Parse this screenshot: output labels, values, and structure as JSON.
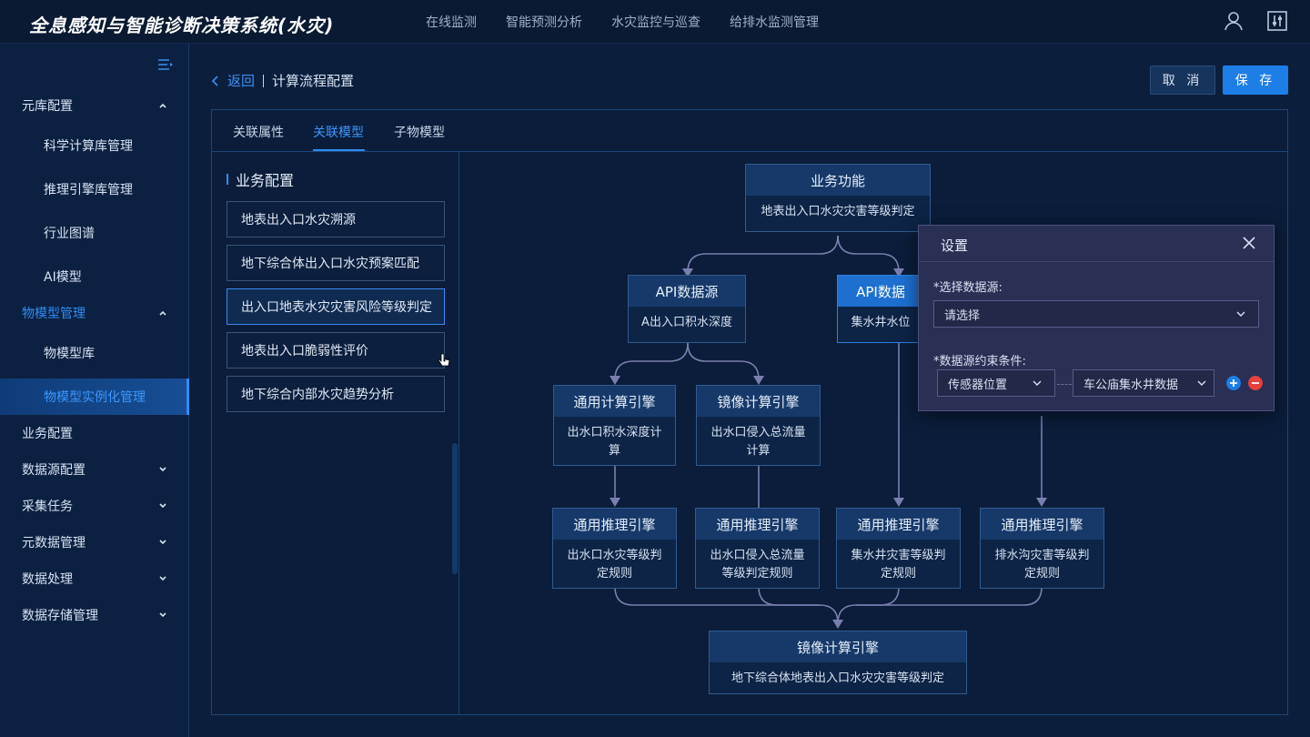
{
  "header": {
    "app_title": "全息感知与智能诊断决策系统(水灾)",
    "nav": [
      "在线监测",
      "智能预测分析",
      "水灾监控与巡查",
      "给排水监测管理"
    ],
    "user_icon": "user-icon",
    "settings_icon": "sliders-icon"
  },
  "sidebar": {
    "items": [
      {
        "label": "元库配置",
        "level": 1,
        "state": "expanded"
      },
      {
        "label": "科学计算库管理",
        "level": 2
      },
      {
        "label": "推理引擎库管理",
        "level": 2
      },
      {
        "label": "行业图谱",
        "level": 2
      },
      {
        "label": "AI模型",
        "level": 2
      },
      {
        "label": "物模型管理",
        "level": 1,
        "state": "expanded"
      },
      {
        "label": "物模型库",
        "level": 2
      },
      {
        "label": "物模型实例化管理",
        "level": 2,
        "state": "active"
      },
      {
        "label": "业务配置",
        "level": 1
      },
      {
        "label": "数据源配置",
        "level": 1,
        "state": "collapsed"
      },
      {
        "label": "采集任务",
        "level": 1,
        "state": "collapsed"
      },
      {
        "label": "元数据管理",
        "level": 1,
        "state": "collapsed"
      },
      {
        "label": "数据处理",
        "level": 1,
        "state": "collapsed"
      },
      {
        "label": "数据存储管理",
        "level": 1,
        "state": "collapsed"
      }
    ]
  },
  "breadcrumb": {
    "back": "返回",
    "title": "计算流程配置"
  },
  "actions": {
    "cancel": "取 消",
    "save": "保 存"
  },
  "tabs": [
    {
      "label": "关联属性"
    },
    {
      "label": "关联模型",
      "active": true
    },
    {
      "label": "子物模型"
    }
  ],
  "business": {
    "title": "业务配置",
    "items": [
      "地表出入口水灾溯源",
      "地下综合体出入口水灾预案匹配",
      "出入口地表水灾灾害风险等级判定",
      "地表出入口脆弱性评价",
      "地下综合内部水灾趋势分析"
    ],
    "selected_index": 2
  },
  "flow": {
    "nodes": {
      "biz": {
        "header": "业务功能",
        "body": "地表出入口水灾灾害等级判定"
      },
      "api1": {
        "header": "API数据源",
        "body": "A出入口积水深度"
      },
      "api2": {
        "header": "API数据",
        "body": "集水井水位"
      },
      "calc1": {
        "header": "通用计算引擎",
        "body": "出水口积水深度计算"
      },
      "calc2": {
        "header": "镜像计算引擎",
        "body": "出水口侵入总流量计算"
      },
      "inf1": {
        "header": "通用推理引擎",
        "body": "出水口水灾等级判定规则"
      },
      "inf2": {
        "header": "通用推理引擎",
        "body": "出水口侵入总流量等级判定规则"
      },
      "inf3": {
        "header": "通用推理引擎",
        "body": "集水井灾害等级判定规则"
      },
      "inf4": {
        "header": "通用推理引擎",
        "body": "排水沟灾害等级判定规则"
      },
      "final": {
        "header": "镜像计算引擎",
        "body": "地下综合体地表出入口水灾灾害等级判定"
      }
    }
  },
  "dialog": {
    "title": "设置",
    "source_label": "*选择数据源:",
    "source_placeholder": "请选择",
    "constraint_label": "*数据源约束条件:",
    "constraint_field": "传感器位置",
    "constraint_value": "车公庙集水井数据",
    "add_color": "#1d7ee8",
    "remove_color": "#e8403a"
  }
}
